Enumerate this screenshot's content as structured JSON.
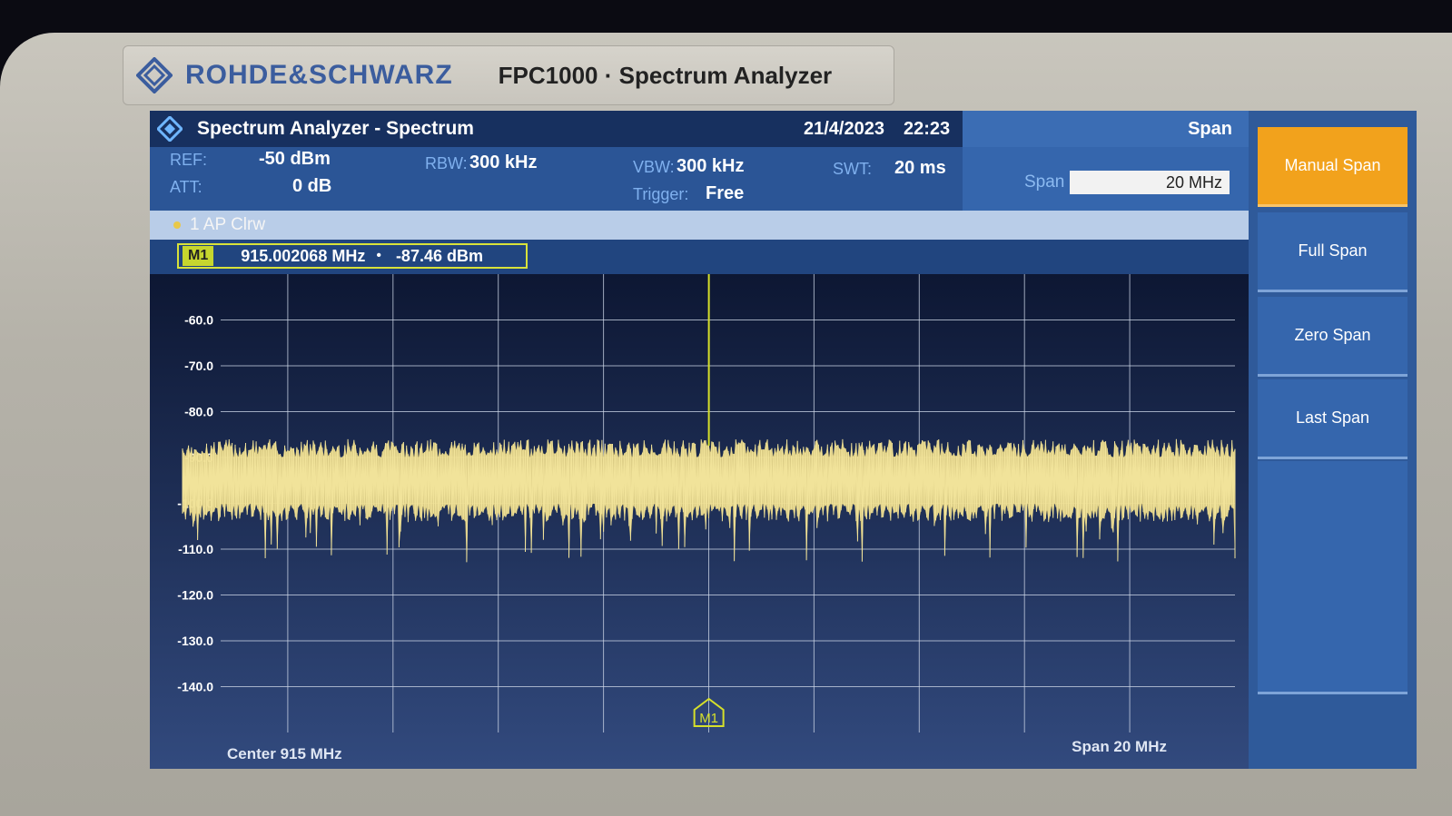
{
  "brand": {
    "name": "ROHDE&SCHWARZ",
    "model": "FPC1000 · Spectrum Analyzer"
  },
  "titlebar": {
    "title": "Spectrum Analyzer - Spectrum",
    "date": "21/4/2023",
    "time": "22:23",
    "menu_title": "Span"
  },
  "params": {
    "ref_label": "REF:",
    "ref_value": "-50 dBm",
    "att_label": "ATT:",
    "att_value": "0 dB",
    "rbw_label": "RBW:",
    "rbw_value": "300 kHz",
    "vbw_label": "VBW:",
    "vbw_value": "300 kHz",
    "trigger_label": "Trigger:",
    "trigger_value": "Free",
    "swt_label": "SWT:",
    "swt_value": "20 ms"
  },
  "span_input": {
    "label": "Span",
    "value": "20 MHz"
  },
  "trace": {
    "label": "1 AP Clrw",
    "color": "#e8d27a"
  },
  "marker": {
    "tag": "M1",
    "frequency": "915.002068 MHz",
    "level": "-87.46 dBm",
    "dot": "•"
  },
  "softkeys": [
    {
      "label": "Manual Span",
      "active": true
    },
    {
      "label": "Full Span",
      "active": false
    },
    {
      "label": "Zero Span",
      "active": false
    },
    {
      "label": "Last Span",
      "active": false
    },
    {
      "label": "",
      "active": false
    },
    {
      "label": "",
      "active": false
    },
    {
      "label": "",
      "active": false
    }
  ],
  "chart_data": {
    "type": "line",
    "title": "",
    "xlabel": "",
    "ylabel": "",
    "x_center_label": "Center 915 MHz",
    "x_span_label": "Span 20 MHz",
    "y_ticks": [
      "-60.0",
      "-70.0",
      "-80.0",
      "-90.0",
      "-100.0",
      "-110.0",
      "-120.0",
      "-130.0",
      "-140.0"
    ],
    "ylim": [
      -150,
      -50
    ],
    "xlim_mhz": [
      905,
      925
    ],
    "grid": true,
    "marker_x_mhz": 915.002068,
    "marker_y_dbm": -87.46,
    "noise_floor_dbm": {
      "peak_max": -87,
      "band_top": -90,
      "band_bottom": -100,
      "dip_min": -113
    },
    "series": [
      {
        "values_description_range": [
          -113,
          -87
        ],
        "color": "#e8d27a"
      }
    ],
    "colors": {
      "background": "#0d1733",
      "grid": "#cfd8e8",
      "trace": "#e8d27a",
      "marker_line": "#d6e02a"
    }
  }
}
